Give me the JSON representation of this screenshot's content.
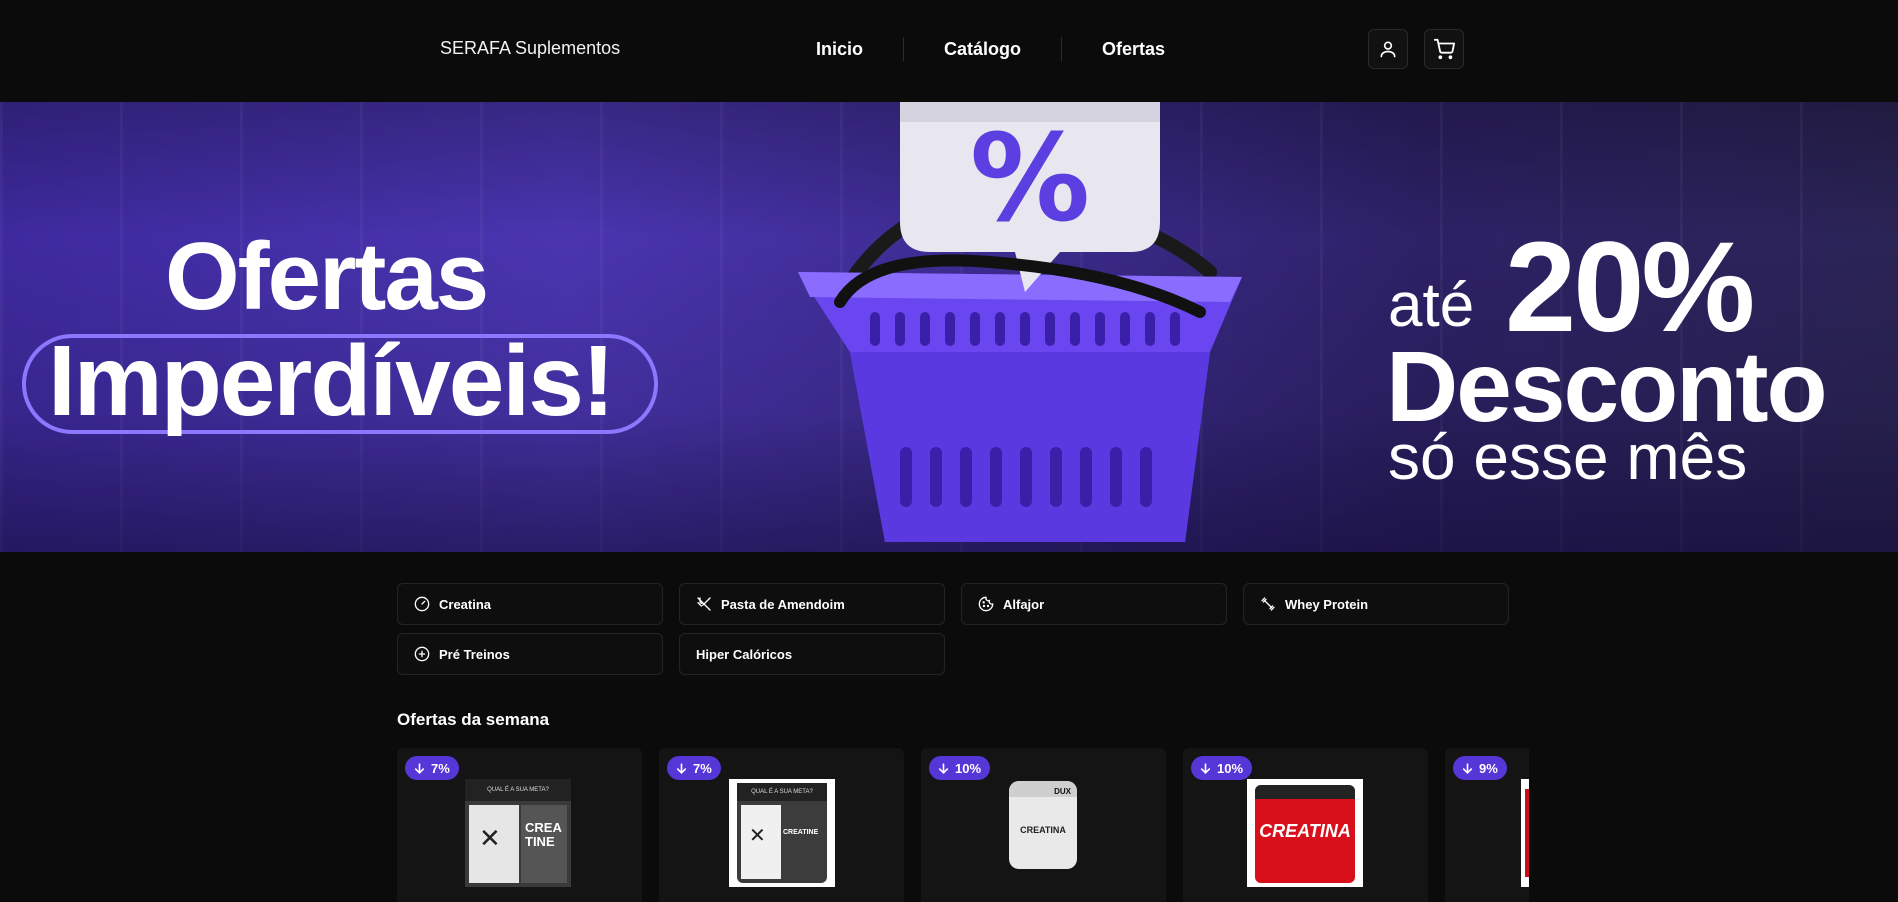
{
  "header": {
    "brand": "SERAFA Suplementos",
    "nav": [
      "Inicio",
      "Catálogo",
      "Ofertas"
    ]
  },
  "banner": {
    "line1": "Ofertas",
    "line2": "Imperdíveis!",
    "ate": "até",
    "percent": "20%",
    "desconto": "Desconto",
    "so_mes": "só esse mês",
    "tag_symbol": "%"
  },
  "categories": [
    {
      "label": "Creatina",
      "icon": "gauge-icon"
    },
    {
      "label": "Pasta de Amendoim",
      "icon": "utensils-crossed-icon"
    },
    {
      "label": "Alfajor",
      "icon": "cookie-icon"
    },
    {
      "label": "Whey Protein",
      "icon": "dumbbell-icon"
    },
    {
      "label": "Pré Treinos",
      "icon": "plus-circle-icon"
    },
    {
      "label": "Hiper Calóricos",
      "icon": ""
    }
  ],
  "offers": {
    "title": "Ofertas da semana",
    "items": [
      {
        "discount": "7%",
        "thumb_text_top": "QUAL É A SUA META?",
        "thumb_text_main": "CREA TINE"
      },
      {
        "discount": "7%",
        "thumb_text_top": "QUAL É A SUA META?",
        "thumb_text_main": "CREATINE"
      },
      {
        "discount": "10%",
        "thumb_text_top": "DUX",
        "thumb_text_main": "CREATINA"
      },
      {
        "discount": "10%",
        "thumb_text_top": "",
        "thumb_text_main": "CREATINA"
      },
      {
        "discount": "9%",
        "thumb_text_top": "",
        "thumb_text_main": ""
      }
    ]
  },
  "colors": {
    "accent": "#5536d6",
    "banner_purple": "#4a35b0",
    "background": "#0b0b0b"
  }
}
